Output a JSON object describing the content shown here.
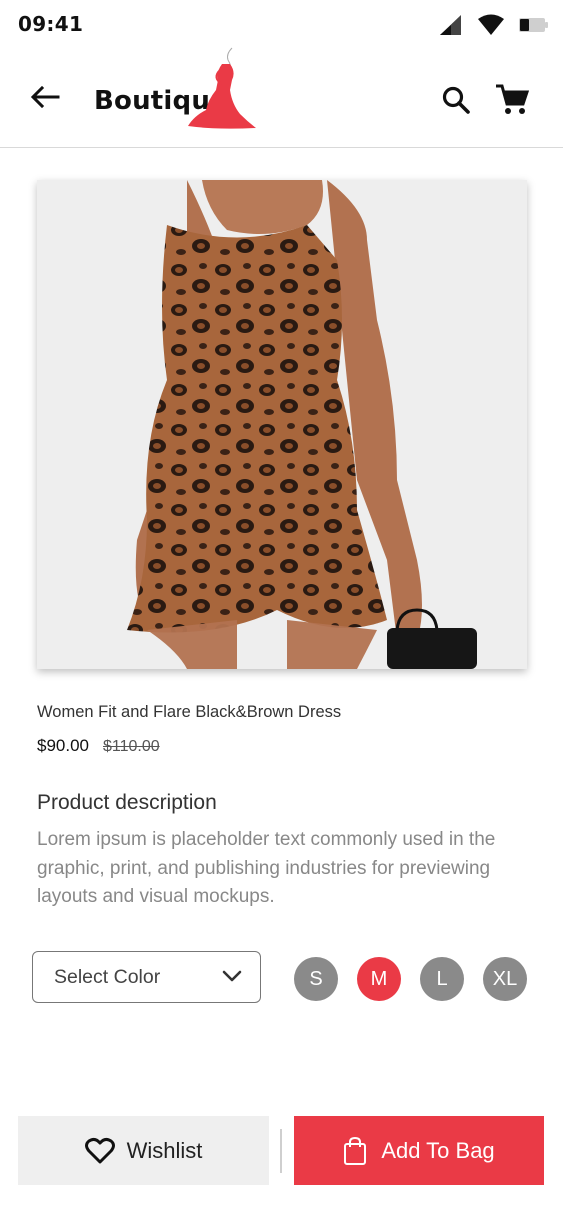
{
  "status_bar": {
    "time": "09:41",
    "icons": [
      "signal-icon",
      "wifi-icon",
      "battery-icon"
    ]
  },
  "app_bar": {
    "back_icon": "arrow-back-icon",
    "brand": "Boutique",
    "logo_icon": "red-dress-logo",
    "search_icon": "search-icon",
    "cart_icon": "cart-icon"
  },
  "product": {
    "image": "leopard-print-dress-photo",
    "name": "Women Fit and Flare Black&Brown Dress",
    "price": "$90.00",
    "old_price": "$110.00",
    "description_title": "Product description",
    "description": "Lorem ipsum is placeholder text commonly used in the graphic, print, and publishing industries for previewing layouts and visual mockups."
  },
  "options": {
    "color_select": {
      "label": "Select Color",
      "icon": "chevron-down-icon"
    },
    "sizes": [
      {
        "label": "S",
        "selected": false
      },
      {
        "label": "M",
        "selected": true
      },
      {
        "label": "L",
        "selected": false
      },
      {
        "label": "XL",
        "selected": false
      }
    ]
  },
  "actions": {
    "wishlist_label": "Wishlist",
    "wishlist_icon": "heart-icon",
    "bag_label": "Add To Bag",
    "bag_icon": "shopping-bag-icon"
  },
  "colors": {
    "accent": "#ea3a46",
    "chip_grey": "#8a8a8a",
    "wishlist_bg": "#efefef"
  }
}
